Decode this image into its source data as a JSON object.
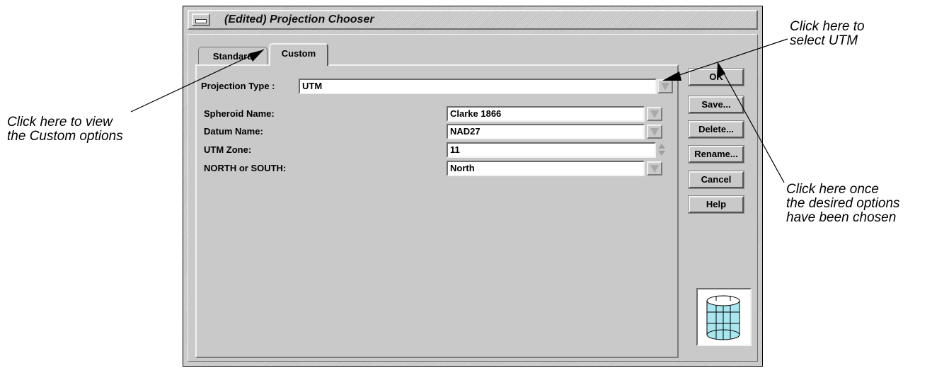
{
  "window": {
    "title": "(Edited) Projection Chooser"
  },
  "tabs": [
    {
      "label": "Standard"
    },
    {
      "label": "Custom"
    }
  ],
  "projection_type": {
    "label": "Projection Type :",
    "value": "UTM"
  },
  "params": [
    {
      "label": "Spheroid Name:",
      "value": "Clarke 1866"
    },
    {
      "label": "Datum Name:",
      "value": "NAD27"
    },
    {
      "label": "UTM Zone:",
      "value": "11"
    },
    {
      "label": "NORTH or SOUTH:",
      "value": "North"
    }
  ],
  "buttons": {
    "ok": "OK",
    "save": "Save...",
    "delete": "Delete...",
    "rename": "Rename...",
    "cancel": "Cancel",
    "help": "Help"
  },
  "icons": {
    "menu": "window-menu-icon",
    "dropdown": "dropdown-arrow-icon",
    "spinner": "spinner-icon",
    "projection": "cylinder-projection-icon"
  },
  "callouts": {
    "custom_tab": [
      "Click here to view",
      "the Custom options"
    ],
    "select_utm": [
      "Click here to",
      "select UTM"
    ],
    "ok_button": [
      "Click here once",
      "the desired options",
      "have been chosen"
    ]
  },
  "colors": {
    "globe_fill": "#a8e6f0",
    "window_gray": "#c9c9c9"
  }
}
